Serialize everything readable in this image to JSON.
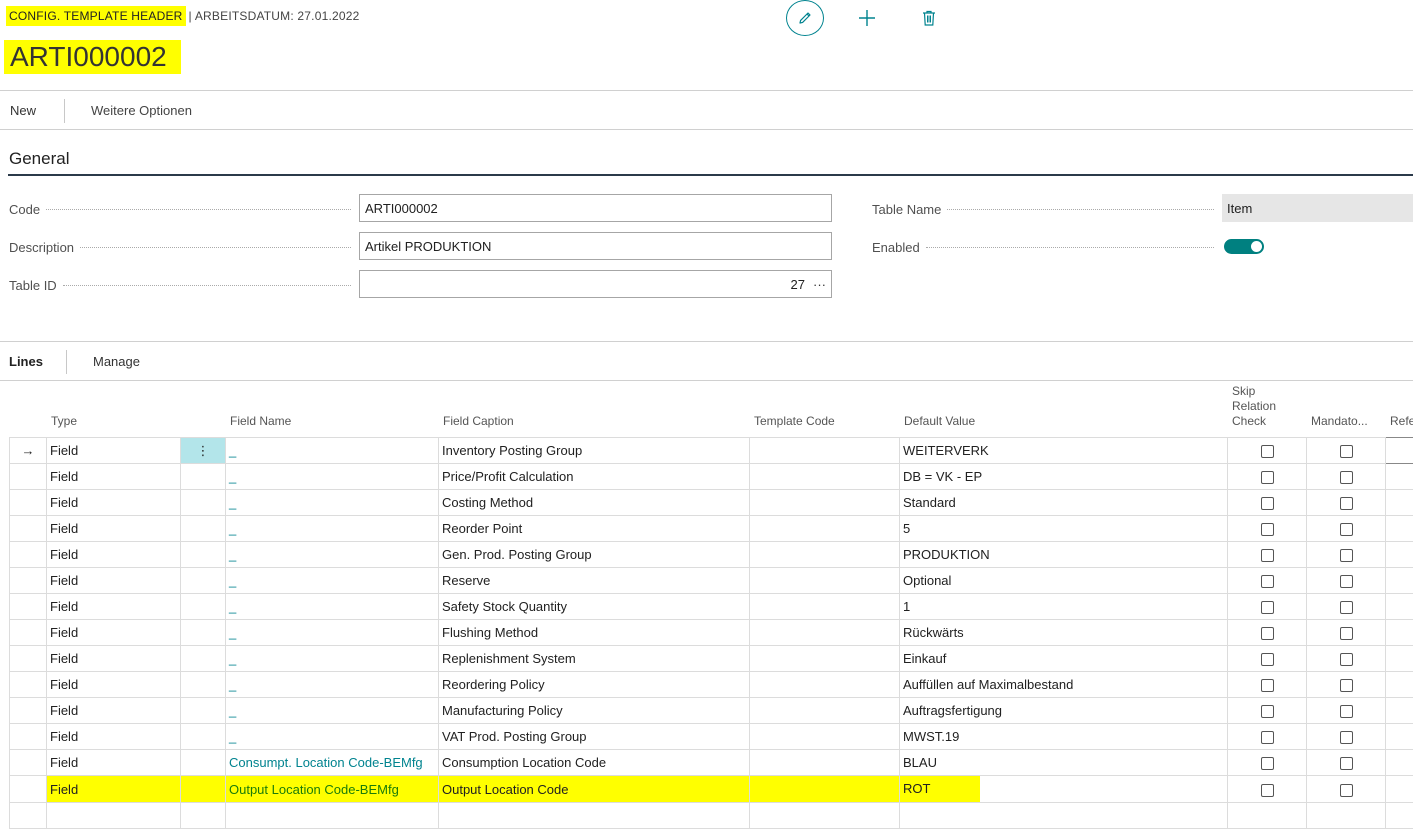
{
  "header": {
    "breadcrumb_page": "CONFIG. TEMPLATE HEADER",
    "breadcrumb_separator": "|",
    "breadcrumb_date": "ARBEITSDATUM: 27.01.2022",
    "record_title": "ARTI000002",
    "icons": [
      "pencil-icon",
      "plus-icon",
      "trash-icon"
    ]
  },
  "actions": {
    "new_label": "New",
    "more_label": "Weitere Optionen"
  },
  "general": {
    "section_title": "General",
    "code_label": "Code",
    "code_value": "ARTI000002",
    "description_label": "Description",
    "description_value": "Artikel PRODUKTION",
    "table_id_label": "Table ID",
    "table_id_value": "27",
    "table_id_lookup": "···",
    "table_name_label": "Table Name",
    "table_name_value": "Item",
    "enabled_label": "Enabled",
    "enabled_value": true
  },
  "lines": {
    "tab_lines": "Lines",
    "tab_manage": "Manage",
    "columns": {
      "type": "Type",
      "field_name": "Field Name",
      "field_caption": "Field Caption",
      "template_code": "Template Code",
      "default_value": "Default Value",
      "skip_line1": "Skip",
      "skip_line2": "Relation",
      "skip_line3": "Check",
      "mandatory": "Mandato...",
      "reference": "Refe"
    },
    "row_marker": "→",
    "row_menu": "⋮",
    "rows": [
      {
        "type": "Field",
        "field_name": "_",
        "caption": "Inventory Posting Group",
        "template_code": "",
        "default_value": "WEITERVERK"
      },
      {
        "type": "Field",
        "field_name": "_",
        "caption": "Price/Profit Calculation",
        "template_code": "",
        "default_value": "DB = VK - EP"
      },
      {
        "type": "Field",
        "field_name": "_",
        "caption": "Costing Method",
        "template_code": "",
        "default_value": "Standard"
      },
      {
        "type": "Field",
        "field_name": "_",
        "caption": "Reorder Point",
        "template_code": "",
        "default_value": "5"
      },
      {
        "type": "Field",
        "field_name": "_",
        "caption": "Gen. Prod. Posting Group",
        "template_code": "",
        "default_value": "PRODUKTION"
      },
      {
        "type": "Field",
        "field_name": "_",
        "caption": "Reserve",
        "template_code": "",
        "default_value": "Optional"
      },
      {
        "type": "Field",
        "field_name": "_",
        "caption": "Safety Stock Quantity",
        "template_code": "",
        "default_value": "1"
      },
      {
        "type": "Field",
        "field_name": "_",
        "caption": "Flushing Method",
        "template_code": "",
        "default_value": "Rückwärts"
      },
      {
        "type": "Field",
        "field_name": "_",
        "caption": "Replenishment System",
        "template_code": "",
        "default_value": "Einkauf"
      },
      {
        "type": "Field",
        "field_name": "_",
        "caption": "Reordering Policy",
        "template_code": "",
        "default_value": "Auffüllen auf Maximalbestand"
      },
      {
        "type": "Field",
        "field_name": "_",
        "caption": "Manufacturing Policy",
        "template_code": "",
        "default_value": "Auftragsfertigung"
      },
      {
        "type": "Field",
        "field_name": "_",
        "caption": "VAT Prod. Posting Group",
        "template_code": "",
        "default_value": "MWST.19"
      },
      {
        "type": "Field",
        "field_name": "Consumpt. Location Code-BEMfg",
        "caption": "Consumption Location Code",
        "template_code": "",
        "default_value": "BLAU"
      },
      {
        "type": "Field",
        "field_name": "Output Location Code-BEMfg",
        "caption": "Output Location Code",
        "template_code": "",
        "default_value": "ROT"
      }
    ]
  },
  "colors": {
    "accent": "#00838f",
    "highlight": "#ffff00",
    "toggle_on": "#008080"
  }
}
